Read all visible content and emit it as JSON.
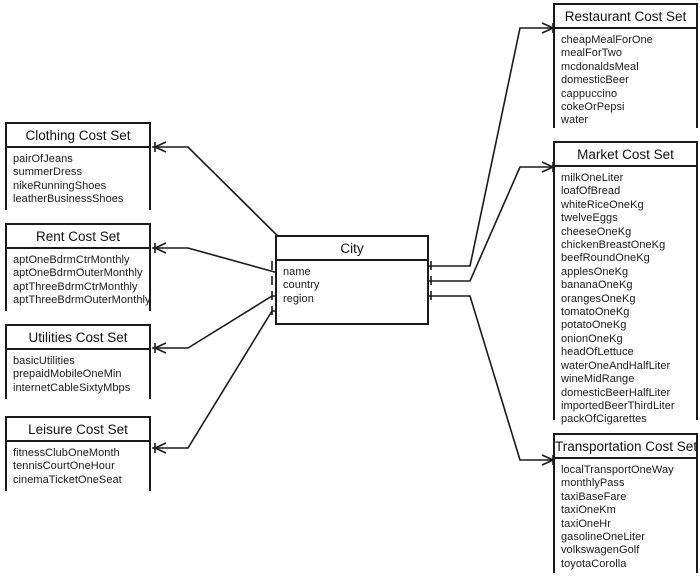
{
  "diagram": {
    "type": "entity-relationship-diagram",
    "background_color": "#ffffff",
    "line_color": "#1a1a1a",
    "central_entity": "City"
  },
  "entities": {
    "city": {
      "title": "City",
      "attributes": [
        "name",
        "country",
        "region"
      ]
    },
    "clothing": {
      "title": "Clothing Cost Set",
      "attributes": [
        "pairOfJeans",
        "summerDress",
        "nikeRunningShoes",
        "leatherBusinessShoes"
      ]
    },
    "rent": {
      "title": "Rent Cost Set",
      "attributes": [
        "aptOneBdrmCtrMonthly",
        "aptOneBdrmOuterMonthly",
        "aptThreeBdrmCtrMonthly",
        "aptThreeBdrmOuterMonthly"
      ]
    },
    "utilities": {
      "title": "Utilities Cost Set",
      "attributes": [
        "basicUtilities",
        "prepaidMobileOneMin",
        "internetCableSixtyMbps"
      ]
    },
    "leisure": {
      "title": "Leisure Cost Set",
      "attributes": [
        "fitnessClubOneMonth",
        "tennisCourtOneHour",
        "cinemaTicketOneSeat"
      ]
    },
    "restaurant": {
      "title": "Restaurant Cost Set",
      "attributes": [
        "cheapMealForOne",
        "mealForTwo",
        "mcdonaldsMeal",
        "domesticBeer",
        "cappuccino",
        "cokeOrPepsi",
        "water"
      ]
    },
    "market": {
      "title": "Market Cost Set",
      "attributes": [
        "milkOneLiter",
        "loafOfBread",
        "whiteRiceOneKg",
        "twelveEggs",
        "cheeseOneKg",
        "chickenBreastOneKg",
        "beefRoundOneKg",
        "applesOneKg",
        "bananaOneKg",
        "orangesOneKg",
        "tomatoOneKg",
        "potatoOneKg",
        "onionOneKg",
        "headOfLettuce",
        "waterOneAndHalfLiter",
        "wineMidRange",
        "domesticBeerHalfLiter",
        "importedBeerThirdLiter",
        "packOfCigarettes"
      ]
    },
    "transportation": {
      "title": "Transportation Cost Set",
      "attributes": [
        "localTransportOneWay",
        "monthlyPass",
        "taxiBaseFare",
        "taxiOneKm",
        "taxiOneHr",
        "gasolineOneLiter",
        "volkswagenGolf",
        "toyotaCorolla"
      ]
    }
  },
  "relationships": [
    {
      "from": "clothing",
      "to": "city",
      "from_cardinality": "one-to-many",
      "to_cardinality": "one-and-only-one"
    },
    {
      "from": "rent",
      "to": "city",
      "from_cardinality": "one-to-many",
      "to_cardinality": "one-and-only-one"
    },
    {
      "from": "utilities",
      "to": "city",
      "from_cardinality": "one-to-many",
      "to_cardinality": "one-and-only-one"
    },
    {
      "from": "leisure",
      "to": "city",
      "from_cardinality": "one-to-many",
      "to_cardinality": "one-and-only-one"
    },
    {
      "from": "city",
      "to": "restaurant",
      "from_cardinality": "one-and-only-one",
      "to_cardinality": "one-to-many"
    },
    {
      "from": "city",
      "to": "market",
      "from_cardinality": "one-and-only-one",
      "to_cardinality": "one-to-many"
    },
    {
      "from": "city",
      "to": "transportation",
      "from_cardinality": "one-and-only-one",
      "to_cardinality": "one-to-many"
    }
  ]
}
